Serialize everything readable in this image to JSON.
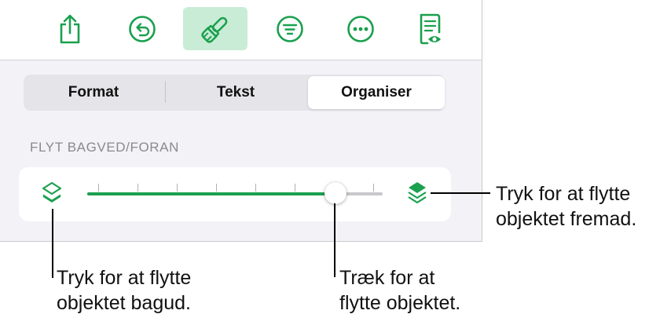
{
  "toolbar": {
    "buttons": [
      {
        "name": "share-icon"
      },
      {
        "name": "undo-icon"
      },
      {
        "name": "paintbrush-icon",
        "active": true
      },
      {
        "name": "filter-icon"
      },
      {
        "name": "more-icon"
      },
      {
        "name": "reading-view-icon"
      }
    ]
  },
  "tabs": {
    "items": [
      "Format",
      "Tekst",
      "Organiser"
    ],
    "selected": "Organiser"
  },
  "section": {
    "title": "FLYT BAGVED/FORAN"
  },
  "slider": {
    "value_fraction": 0.84,
    "tick_count": 8,
    "back_icon": "send-backward-icon",
    "front_icon": "bring-forward-icon"
  },
  "callouts": {
    "right_line1": "Tryk for at flytte",
    "right_line2": "objektet fremad.",
    "left_line1": "Tryk for at flytte",
    "left_line2": "objektet bagud.",
    "middle_line1": "Træk for at",
    "middle_line2": "flytte objektet."
  },
  "colors": {
    "accent": "#1aa04e",
    "active_bg": "#c9ecd6",
    "panel_bg": "#f2f2f7"
  }
}
